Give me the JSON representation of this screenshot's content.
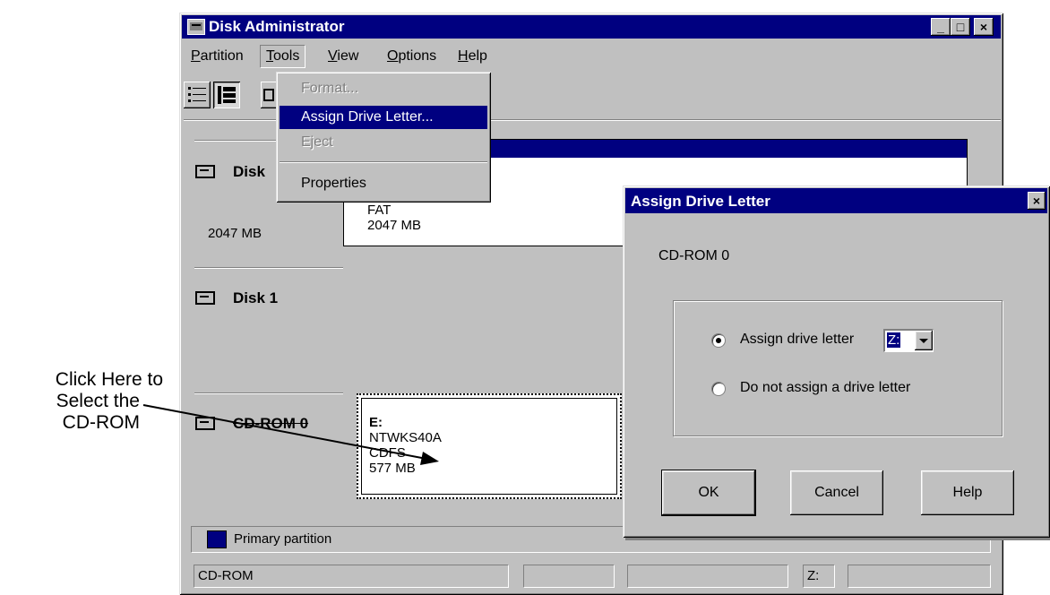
{
  "window": {
    "title": "Disk Administrator",
    "controls": {
      "minimize": "_",
      "maximize": "□",
      "close": "×"
    }
  },
  "menu": [
    {
      "label": "Partition",
      "mnemonic": "P",
      "rest": "artition"
    },
    {
      "label": "Tools",
      "mnemonic": "T",
      "rest": "ools"
    },
    {
      "label": "View",
      "mnemonic": "V",
      "rest": "iew"
    },
    {
      "label": "Options",
      "mnemonic": "O",
      "rest": "ptions"
    },
    {
      "label": "Help",
      "mnemonic": "H",
      "rest": "elp"
    }
  ],
  "tools_menu": {
    "items": [
      {
        "label": "Format...",
        "state": "disabled"
      },
      {
        "label": "Assign Drive Letter...",
        "state": "highlighted"
      },
      {
        "label": "Eject",
        "state": "disabled"
      },
      {
        "label": "Properties",
        "state": "enabled"
      }
    ]
  },
  "disks": [
    {
      "name": "Disk",
      "size": "2047 MB",
      "partition": {
        "fs": "FAT",
        "size": "2047 MB"
      }
    },
    {
      "name": "Disk 1"
    },
    {
      "name": "CD-ROM 0",
      "partition": {
        "letter": "E:",
        "label": "NTWKS40A",
        "fs": "CDFS",
        "size": "577 MB"
      }
    }
  ],
  "legend": {
    "label": "Primary partition",
    "color": "#000080"
  },
  "status_bar": {
    "left": "CD-ROM",
    "drive": "Z:"
  },
  "annotation": {
    "text_line1": "Click Here to",
    "text_line2": "Select the",
    "text_line3": "CD-ROM"
  },
  "dialog": {
    "title": "Assign Drive Letter",
    "device": "CD-ROM 0",
    "option_assign": "Assign drive letter",
    "option_none": "Do not assign a drive letter",
    "selected_letter": "Z:",
    "buttons": {
      "ok": "OK",
      "cancel": "Cancel",
      "help": "Help"
    }
  },
  "colors": {
    "title_bar": "#000080",
    "face": "#c0c0c0",
    "highlight": "#000080"
  }
}
